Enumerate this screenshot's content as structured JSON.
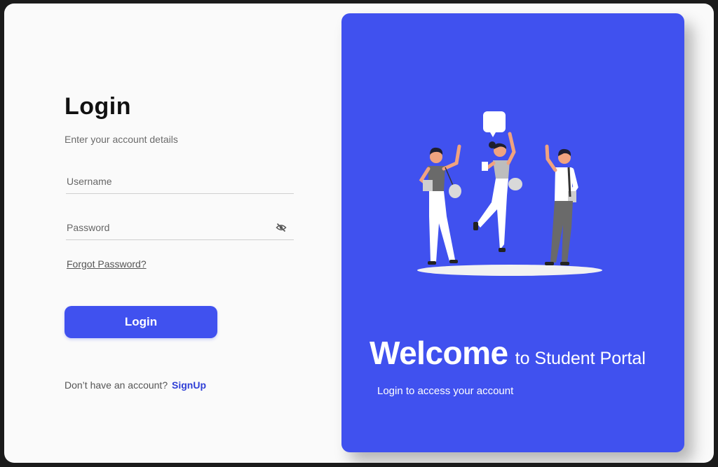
{
  "login": {
    "title": "Login",
    "subtitle": "Enter your account details",
    "username_placeholder": "Username",
    "password_placeholder": "Password",
    "forgot_password": "Forgot Password?",
    "button_label": "Login",
    "signup_prompt": "Don’t have an account?",
    "signup_link": "SignUp"
  },
  "panel": {
    "welcome": "Welcome",
    "welcome_suffix": "to Student Portal",
    "subtitle": "Login to access your account"
  },
  "icons": {
    "password_toggle": "eye-off-icon",
    "illustration": "students-illustration"
  },
  "colors": {
    "accent": "#4051ef",
    "link": "#2f3fd6",
    "background": "#fafafa"
  }
}
